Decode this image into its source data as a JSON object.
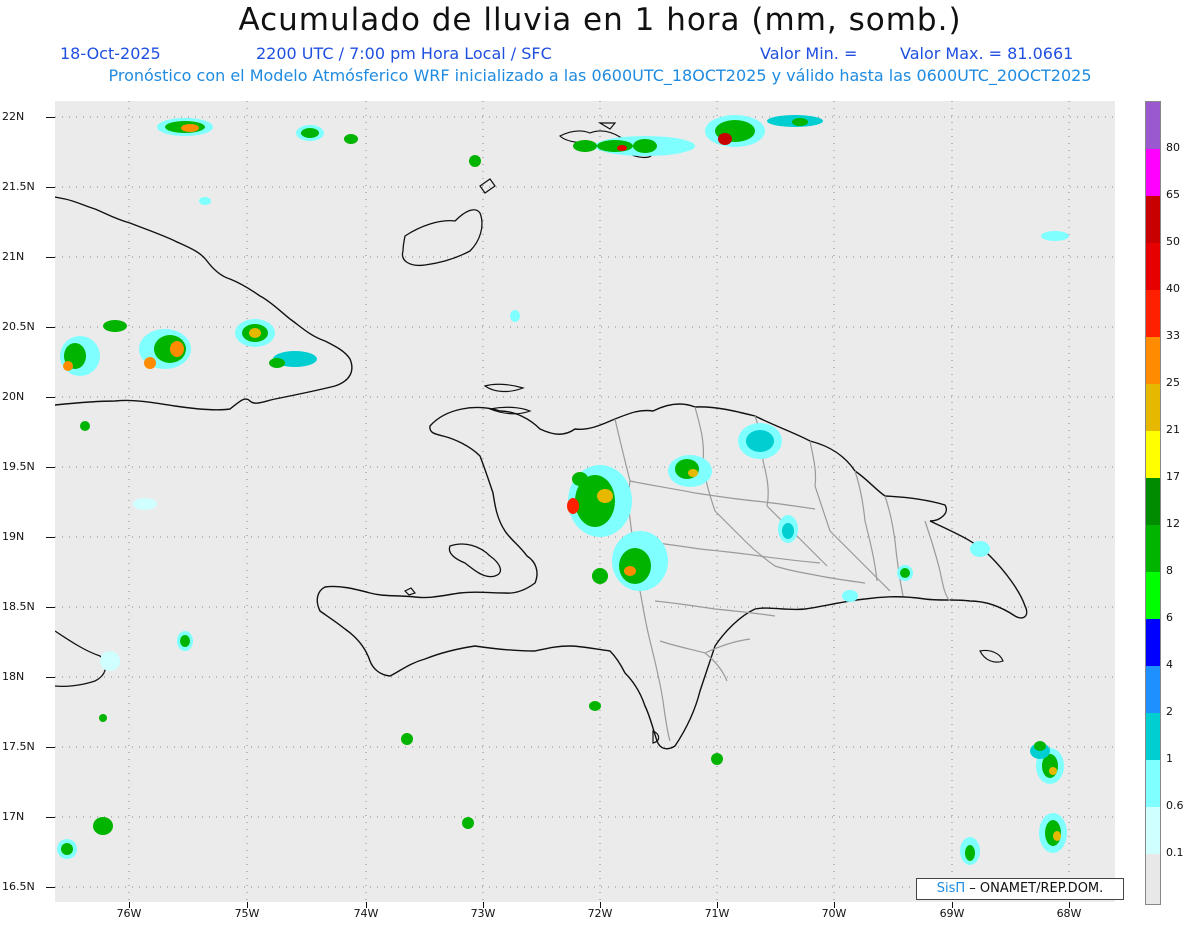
{
  "title": "Acumulado de lluvia en 1 hora (mm, somb.)",
  "subtitle": {
    "date": "18-Oct-2025",
    "time": "2200 UTC / 7:00 pm Hora Local / SFC",
    "valor_min": "Valor Min. =",
    "valor_max": "Valor Max. = 81.0661"
  },
  "model_line": "Pronóstico con el Modelo Atmósferico WRF inicializado a las 0600UTC_18OCT2025 y válido hasta las  0600UTC_20OCT2025",
  "lat_labels": [
    "22N",
    "21.5N",
    "21N",
    "20.5N",
    "20N",
    "19.5N",
    "19N",
    "18.5N",
    "18N",
    "17.5N",
    "17N",
    "16.5N"
  ],
  "lon_labels": [
    "76W",
    "75W",
    "74W",
    "73W",
    "72W",
    "71W",
    "70W",
    "69W",
    "68W"
  ],
  "legend": {
    "labels": [
      "80",
      "65",
      "50",
      "40",
      "33",
      "25",
      "21",
      "17",
      "12",
      "8",
      "6",
      "4",
      "2",
      "1",
      "0.6",
      "0.1"
    ],
    "colors": [
      "#9b59d0",
      "#ff00ff",
      "#c80000",
      "#e60000",
      "#ff2000",
      "#ff8c00",
      "#e6b800",
      "#ffff00",
      "#008c00",
      "#00b400",
      "#00ff00",
      "#0000ff",
      "#1e90ff",
      "#00ced1",
      "#7fffff",
      "#cfffff",
      "#e8e8e8"
    ]
  },
  "credit": {
    "brand": "SisΠ",
    "org": " – ONAMET/REP.DOM."
  },
  "colors": {
    "map_bg": "#ebebeb",
    "coast": "#111111",
    "provinces": "#9a9a9a",
    "grid": "#888888"
  }
}
